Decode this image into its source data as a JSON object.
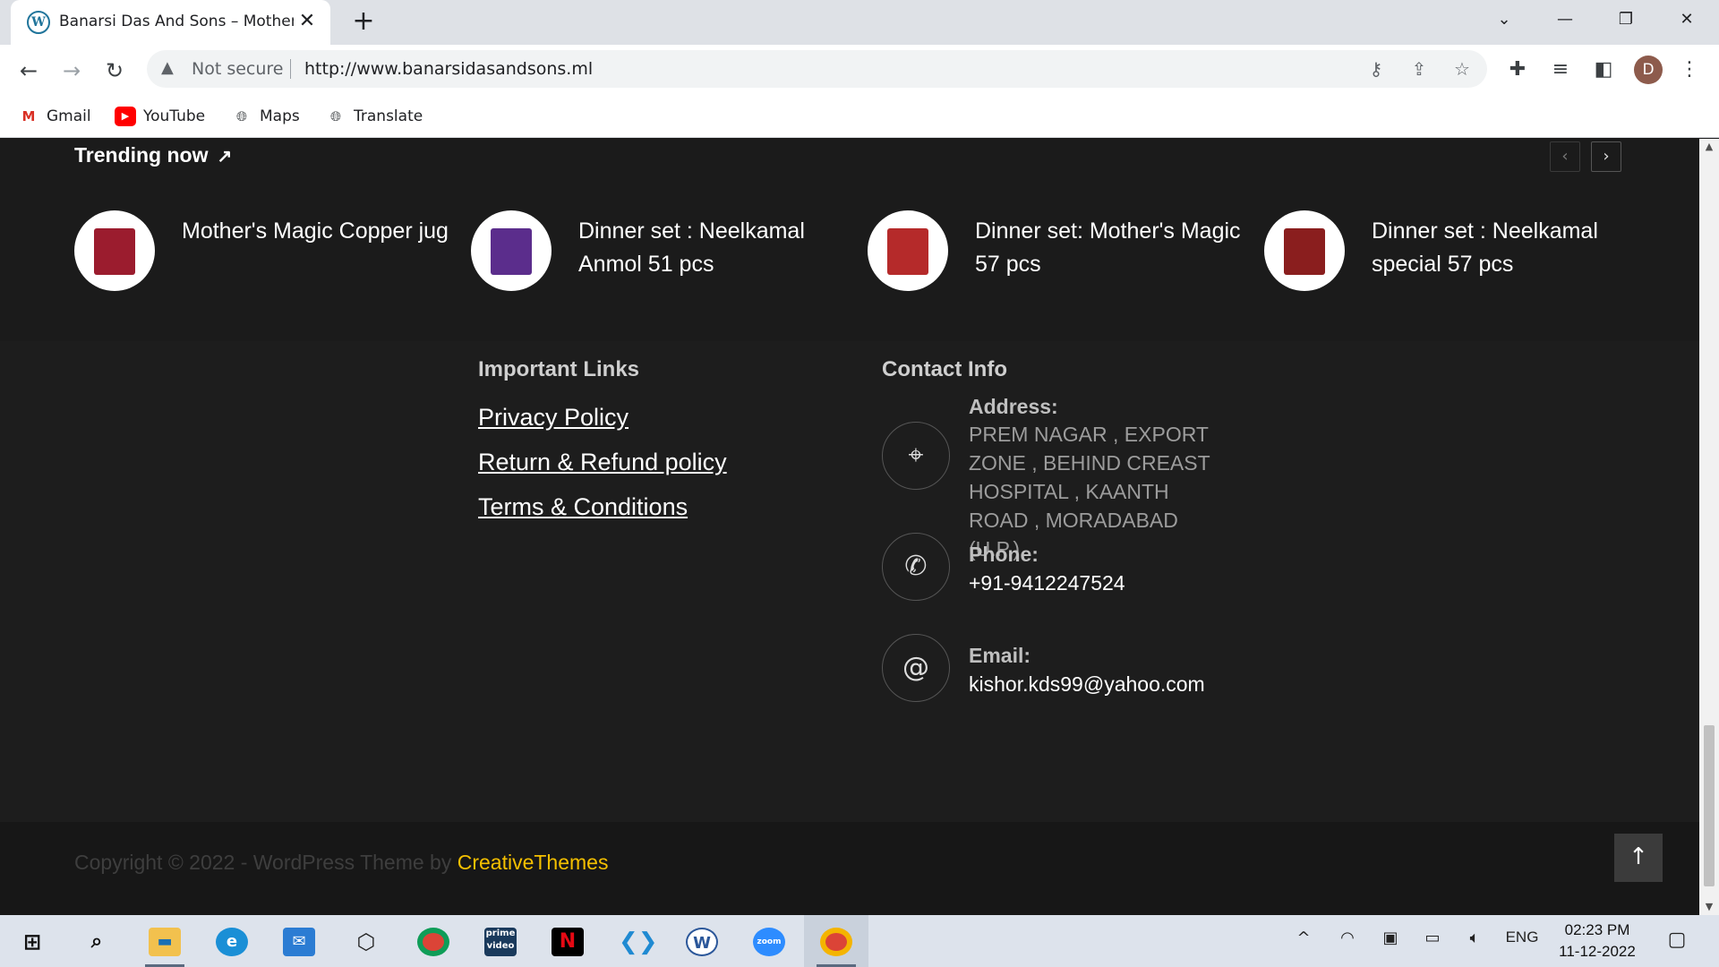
{
  "browser": {
    "tab_title": "Banarsi Das And Sons – Mother's",
    "tab_favicon": "wordpress-icon",
    "address_warning": "Not secure",
    "url": "http://www.banarsidasandsons.ml",
    "bookmarks": [
      {
        "label": "Gmail",
        "icon": "gmail-icon"
      },
      {
        "label": "YouTube",
        "icon": "youtube-icon"
      },
      {
        "label": "Maps",
        "icon": "maps-icon"
      },
      {
        "label": "Translate",
        "icon": "translate-icon"
      }
    ],
    "profile_initial": "D"
  },
  "trending": {
    "title": "Trending now",
    "items": [
      {
        "name": "Mother's Magic Copper jug",
        "color": "#9b1c2e"
      },
      {
        "name": "Dinner set : Neelkamal Anmol 51 pcs",
        "color": "#5b2d8c"
      },
      {
        "name": "Dinner set: Mother's Magic 57 pcs",
        "color": "#b52a2a"
      },
      {
        "name": "Dinner set : Neelkamal special 57 pcs",
        "color": "#8a1e1e"
      }
    ]
  },
  "links": {
    "title": "Important Links",
    "items": [
      "Privacy Policy",
      "Return & Refund policy",
      "Terms & Conditions"
    ]
  },
  "contact": {
    "title": "Contact Info",
    "address_label": "Address:",
    "address_value": "PREM NAGAR , EXPORT ZONE , BEHIND CREAST HOSPITAL , KAANTH ROAD , MORADABAD (U.P.)",
    "phone_label": "Phone:",
    "phone_value": "+91-9412247524",
    "email_label": "Email:",
    "email_value": "kishor.kds99@yahoo.com"
  },
  "footer": {
    "copyright_prefix": "Copyright © 2022 - WordPress Theme by ",
    "brand": "CreativeThemes"
  },
  "taskbar": {
    "apps": [
      "file-explorer-icon",
      "edge-icon",
      "mail-icon",
      "unity-icon",
      "chrome-icon",
      "prime-video-icon",
      "netflix-icon",
      "vscode-icon",
      "wordpad-icon",
      "zoom-icon",
      "chrome-profile-icon"
    ],
    "language": "ENG",
    "time": "02:23 PM",
    "date": "11-12-2022"
  },
  "colors": {
    "accent": "#f5c000",
    "page_bg": "#1b1b1b"
  }
}
